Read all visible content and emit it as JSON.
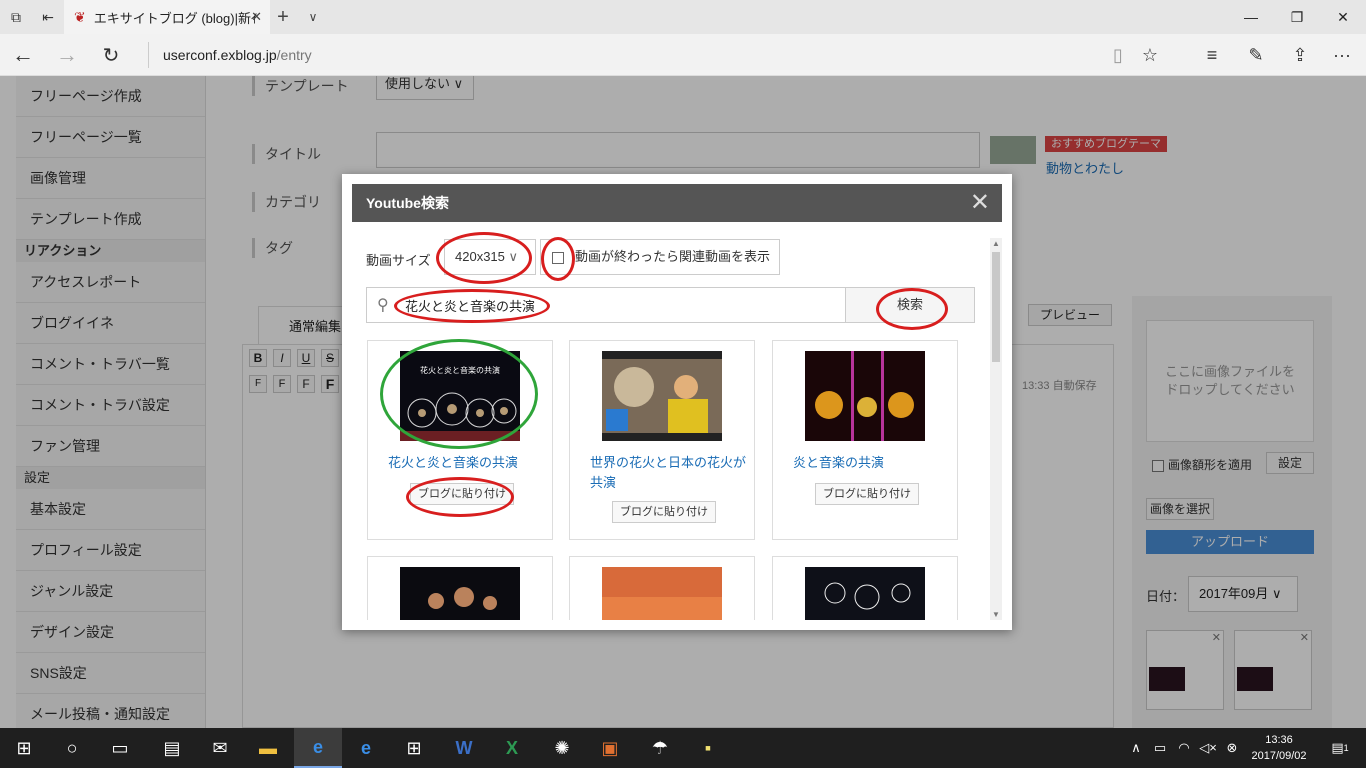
{
  "browser": {
    "tab_title": "エキサイトブログ (blog)|新ｲ",
    "url_domain": "userconf.exblog.jp",
    "url_path": "/entry"
  },
  "sidebar": {
    "items_top": [
      "フリーページ作成",
      "フリーページ一覧",
      "画像管理",
      "テンプレート作成"
    ],
    "section_reaction": "リアクション",
    "items_reaction": [
      "アクセスレポート",
      "ブログイイネ",
      "コメント・トラバ一覧",
      "コメント・トラバ設定",
      "ファン管理"
    ],
    "section_settings": "設定",
    "items_settings": [
      "基本設定",
      "プロフィール設定",
      "ジャンル設定",
      "デザイン設定",
      "SNS設定",
      "メール投稿・通知設定"
    ]
  },
  "editor": {
    "template_label": "テンプレート",
    "template_value": "使用しない",
    "title_label": "タイトル",
    "category_label": "カテゴリ",
    "tag_label": "タグ",
    "recommend_tag": "おすすめブログテーマ",
    "recommend_link": "動物とわたし",
    "tab_normal": "通常編集",
    "preview": "プレビュー",
    "autosave": "13:33 自動保存"
  },
  "right_panel": {
    "drop_text_1": "ここに画像ファイルを",
    "drop_text_2": "ドロップしてください",
    "frame_checkbox": "画像額形を適用",
    "settings_btn": "設定",
    "select_image_btn": "画像を選択",
    "upload_btn": "アップロード",
    "date_label": "日付：",
    "date_value": "2017年09月"
  },
  "modal": {
    "title": "Youtube検索",
    "size_label": "動画サイズ",
    "size_value": "420x315",
    "related_label": "動画が終わったら関連動画を表示",
    "search_value": "花火と炎と音楽の共演",
    "search_btn": "検索",
    "paste_label": "ブログに貼り付け",
    "results": [
      {
        "title": "花火と炎と音楽の共演",
        "thumb_text": "花火と炎と音楽の共演"
      },
      {
        "title": "世界の花火と日本の花火が共演"
      },
      {
        "title": "炎と音楽の共演"
      }
    ]
  },
  "taskbar": {
    "time": "13:36",
    "date": "2017/09/02",
    "notif_count": "1"
  },
  "colors": {
    "annotation_red": "#d81e1e",
    "annotation_green": "#2fa53a",
    "link_blue": "#1a6cb5"
  }
}
